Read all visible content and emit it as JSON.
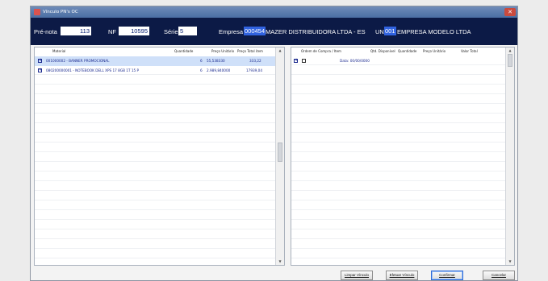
{
  "window": {
    "title": "Vínculo PN's OC",
    "close_label": "✕"
  },
  "header": {
    "prenota_label": "Pré-nota",
    "prenota_value": "113",
    "nf_label": "NF",
    "nf_value": "10595",
    "serie_label": "Série",
    "serie_value": "5",
    "empresa_label": "Empresa",
    "empresa_code": "000454",
    "empresa_name": "MAZER DISTRIBUIDORA LTDA - ES",
    "un_label": "UN",
    "un_code": "001",
    "un_name": "EMPRESA MODELO LTDA"
  },
  "left_grid": {
    "columns": {
      "material": "Material",
      "quantidade": "Quantidade",
      "preco_unitario": "Preço Unitário",
      "preco_total": "Preço Total item"
    },
    "rows": [
      {
        "expand": "+",
        "material": "001000002 - BANNER PROMOCIONAL",
        "quantidade": "6",
        "preco_unitario": "55,538330",
        "preco_total": "333,22"
      },
      {
        "expand": "+",
        "material": "080200000001 - NOTEBOOK DELL XPS 17 8GB 1T 15 P",
        "quantidade": "6",
        "preco_unitario": "2.989,840000",
        "preco_total": "17939,04"
      }
    ]
  },
  "right_grid": {
    "columns": {
      "ordem": "Ordem de Compra / Item",
      "qtd_disponivel": "Qtd. Disponível",
      "quantidade": "Quantidade",
      "preco_unitario": "Preço Unitário",
      "valor_total": "Valor Total"
    },
    "rows": [
      {
        "expand": "+",
        "data_text": "Data: 00/00/0000"
      }
    ]
  },
  "buttons": {
    "limpar": "Limpar Vínculo",
    "efetuar": "Efetuar Vínculo",
    "confirmar": "Confirmar",
    "cancelar": "Cancelar"
  }
}
